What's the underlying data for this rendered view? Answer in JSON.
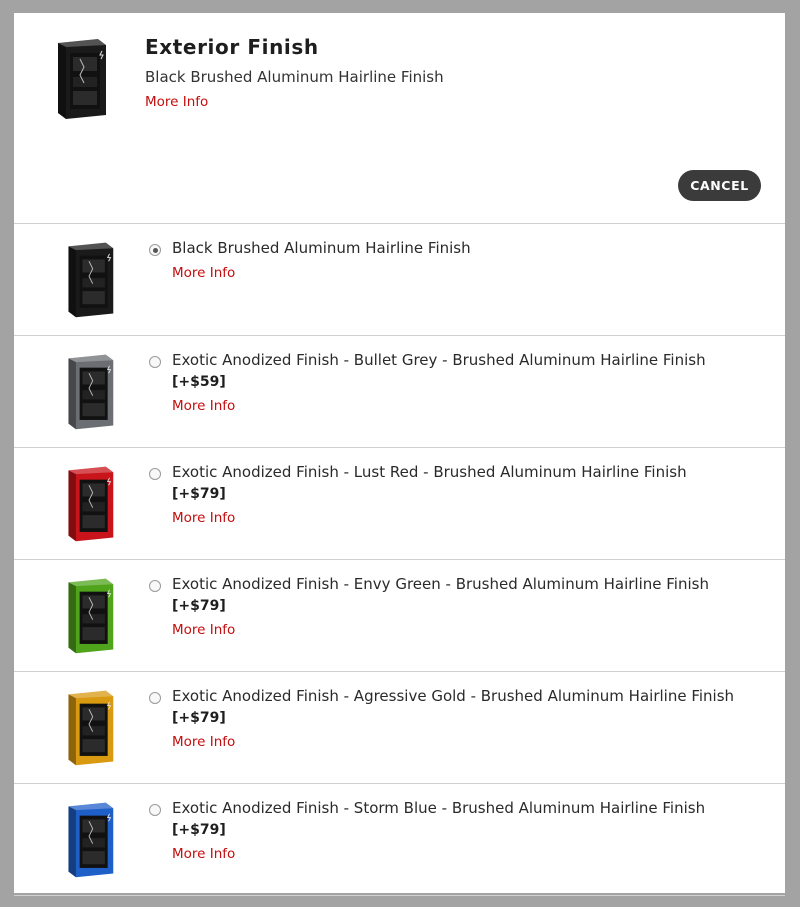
{
  "header": {
    "title": "Exterior Finish",
    "selected_name": "Black Brushed Aluminum Hairline Finish",
    "more_info": "More Info",
    "cancel_label": "CANCEL",
    "thumb_color": "#1a1a1a"
  },
  "options": [
    {
      "name": "Black Brushed Aluminum Hairline Finish",
      "price": "",
      "more_info": "More Info",
      "selected": true,
      "color": "#1a1a1a",
      "icon": "black-case-icon"
    },
    {
      "name": "Exotic Anodized Finish - Bullet Grey - Brushed Aluminum Hairline Finish",
      "price": "[+$59]",
      "more_info": "More Info",
      "selected": false,
      "color": "#6b6e72",
      "icon": "grey-case-icon"
    },
    {
      "name": "Exotic Anodized Finish - Lust Red - Brushed Aluminum Hairline Finish",
      "price": "[+$79]",
      "more_info": "More Info",
      "selected": false,
      "color": "#c8141a",
      "icon": "red-case-icon"
    },
    {
      "name": "Exotic Anodized Finish - Envy Green - Brushed Aluminum Hairline Finish",
      "price": "[+$79]",
      "more_info": "More Info",
      "selected": false,
      "color": "#4fa41c",
      "icon": "green-case-icon"
    },
    {
      "name": "Exotic Anodized Finish - Agressive Gold - Brushed Aluminum Hairline Finish",
      "price": "[+$79]",
      "more_info": "More Info",
      "selected": false,
      "color": "#d99a12",
      "icon": "gold-case-icon"
    },
    {
      "name": "Exotic Anodized Finish - Storm Blue - Brushed Aluminum Hairline Finish",
      "price": "[+$79]",
      "more_info": "More Info",
      "selected": false,
      "color": "#1f5fc8",
      "icon": "blue-case-icon"
    }
  ]
}
